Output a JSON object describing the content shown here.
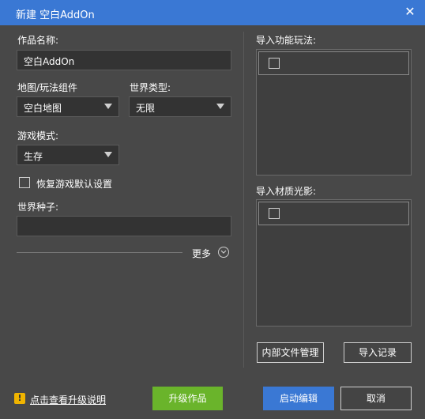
{
  "window": {
    "title": "新建 空白AddOn",
    "close_glyph": "✕"
  },
  "form": {
    "name_label": "作品名称:",
    "name_value": "空白AddOn",
    "map_label": "地图/玩法组件",
    "map_value": "空白地图",
    "world_type_label": "世界类型:",
    "world_type_value": "无限",
    "game_mode_label": "游戏模式:",
    "game_mode_value": "生存",
    "reset_defaults_label": "恢复游戏默认设置",
    "seed_label": "世界种子:",
    "seed_value": "",
    "more_label": "更多"
  },
  "right": {
    "import_behavior_label": "导入功能玩法:",
    "import_resource_label": "导入材质光影:",
    "file_manager_button": "内部文件管理",
    "import_log_button": "导入记录"
  },
  "footer": {
    "warn_glyph": "!",
    "upgrade_link": "点击查看升级说明",
    "upgrade_button": "升级作品",
    "launch_button": "启动编辑",
    "cancel_button": "取消"
  },
  "colors": {
    "titlebar": "#3a78d4",
    "upgrade_button": "#6ab42b",
    "launch_button": "#3a78d4",
    "warning": "#f0b400"
  }
}
